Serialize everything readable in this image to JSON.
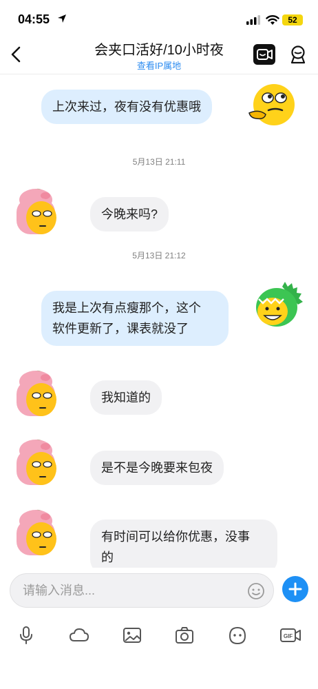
{
  "status_bar": {
    "time": "04:55",
    "battery": "52",
    "icons": [
      "location-arrow-icon",
      "signal-icon",
      "wifi-icon",
      "battery-icon"
    ]
  },
  "header": {
    "title": "会夹口活好/10小时夜",
    "subtitle": "查看IP属地",
    "back_icon": "chevron-left-icon",
    "right_icons": [
      "video-call-icon",
      "profile-icon"
    ]
  },
  "messages": [
    {
      "side": "out",
      "text": "上次来过，夜有没有优惠哦",
      "avatar": "smirk-emoji-avatar"
    },
    {
      "type": "timestamp",
      "text": "5月13日 21:11"
    },
    {
      "side": "in",
      "text": "今晚来吗?",
      "avatar": "pig-hat-avatar"
    },
    {
      "type": "timestamp",
      "text": "5月13日 21:12"
    },
    {
      "side": "out",
      "line1": "我是上次有点瘦那个，这个",
      "line2": "软件更新了，课表就没了",
      "avatar": "green-dino-avatar"
    },
    {
      "side": "in",
      "text": "我知道的",
      "avatar": "pig-hat-avatar"
    },
    {
      "side": "in",
      "text": "是不是今晚要来包夜",
      "avatar": "pig-hat-avatar"
    },
    {
      "side": "in",
      "line1": "有时间可以给你优惠，没事",
      "line2": "的",
      "avatar": "pig-hat-avatar"
    }
  ],
  "input": {
    "placeholder": "请输入消息...",
    "value": ""
  },
  "toolbar": {
    "items": [
      "microphone-icon",
      "cloud-icon",
      "image-icon",
      "camera-icon",
      "emoji-icon",
      "gif-icon"
    ],
    "gif_label": "GIF"
  },
  "colors": {
    "outgoing_bubble": "#ddeefe",
    "incoming_bubble": "#f1f1f3",
    "accent": "#1e90f5",
    "link": "#2d8cf0"
  }
}
